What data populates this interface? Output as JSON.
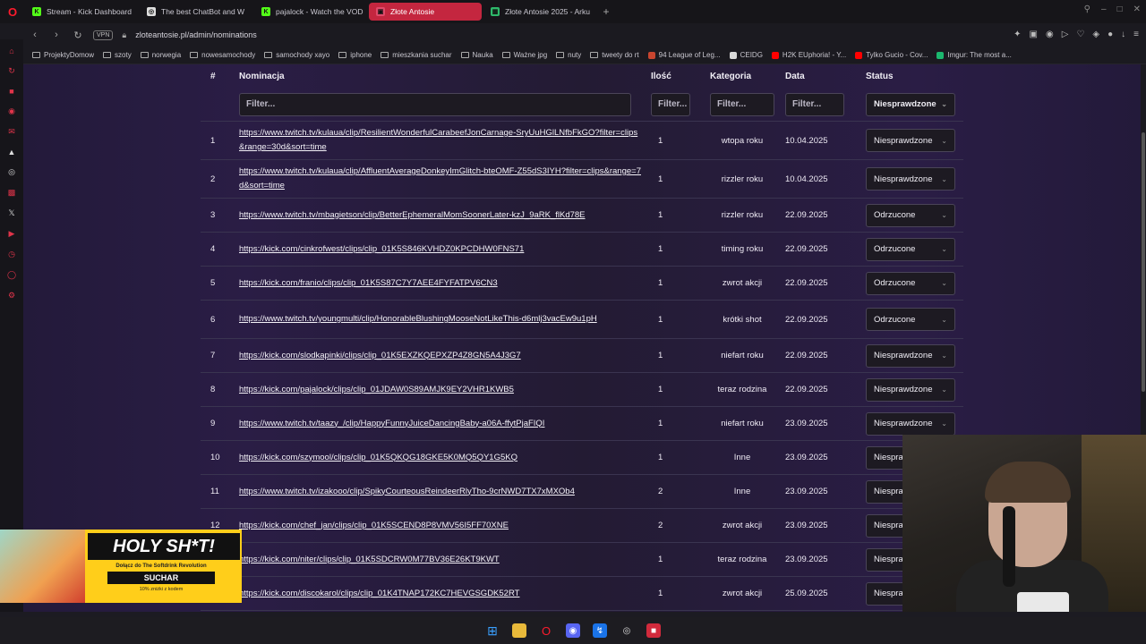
{
  "tabs": [
    {
      "label": "Stream - Kick Dashboard",
      "fav": "K",
      "color": "#53fc18"
    },
    {
      "label": "The best ChatBot and W",
      "fav": "◎",
      "color": "#dddddd"
    },
    {
      "label": "pajalock - Watch the VOD",
      "fav": "K",
      "color": "#53fc18"
    },
    {
      "label": "Złote Antosie",
      "fav": "▣",
      "color": "#e04a6a",
      "active": true
    },
    {
      "label": "Złote Antosie 2025 - Arku",
      "fav": "▦",
      "color": "#2eb86a"
    }
  ],
  "address": {
    "vpn_label": "VPN",
    "url": "zloteantosie.pl/admin/nominations"
  },
  "bookmarks": [
    {
      "label": "ProjektyDomow",
      "type": "folder"
    },
    {
      "label": "szoty",
      "type": "folder"
    },
    {
      "label": "norwegia",
      "type": "folder"
    },
    {
      "label": "nowesamochody",
      "type": "folder"
    },
    {
      "label": "samochody xayo",
      "type": "folder"
    },
    {
      "label": "iphone",
      "type": "folder"
    },
    {
      "label": "mieszkania suchar",
      "type": "folder"
    },
    {
      "label": "Nauka",
      "type": "folder"
    },
    {
      "label": "Ważne jpg",
      "type": "folder"
    },
    {
      "label": "nuty",
      "type": "folder"
    },
    {
      "label": "tweety do rt",
      "type": "folder"
    },
    {
      "label": "94 League of Leg...",
      "type": "site",
      "color": "#c8452f"
    },
    {
      "label": "CEIDG",
      "type": "site",
      "color": "#d9d9d9"
    },
    {
      "label": "H2K EUphoria! - Y...",
      "type": "site",
      "color": "#ff0000"
    },
    {
      "label": "Tylko Gucio - Cov...",
      "type": "site",
      "color": "#ff0000"
    },
    {
      "label": "Imgur: The most a...",
      "type": "site",
      "color": "#1bb76e"
    }
  ],
  "table": {
    "headers": {
      "num": "#",
      "nominacja": "Nominacja",
      "ilosc": "Ilość",
      "kategoria": "Kategoria",
      "data": "Data",
      "status": "Status"
    },
    "filters": {
      "nominacja": "Filter...",
      "ilosc": "Filter...",
      "kategoria": "Filter...",
      "data": "Filter...",
      "status": "Niesprawdzone"
    },
    "rows": [
      {
        "num": "1",
        "link": "https://www.twitch.tv/kulaua/clip/ResilientWonderfulCarabeefJonCarnage-SryUuHGlLNfbFkGO?filter=clips&range=30d&sort=time",
        "ilosc": "1",
        "kategoria": "wtopa roku",
        "data": "10.04.2025",
        "status": "Niesprawdzone"
      },
      {
        "num": "2",
        "link": "https://www.twitch.tv/kulaua/clip/AffluentAverageDonkeyImGlitch-bteOMF-Z55dS3IYH?filter=clips&range=7d&sort=time",
        "ilosc": "1",
        "kategoria": "rizzler roku",
        "data": "10.04.2025",
        "status": "Niesprawdzone"
      },
      {
        "num": "3",
        "link": "https://www.twitch.tv/mbagietson/clip/BetterEphemeralMomSoonerLater-kzJ_9aRK_flKd78E",
        "ilosc": "1",
        "kategoria": "rizzler roku",
        "data": "22.09.2025",
        "status": "Odrzucone"
      },
      {
        "num": "4",
        "link": "https://kick.com/cinkrofwest/clips/clip_01K5S846KVHDZ0KPCDHW0FNS71",
        "ilosc": "1",
        "kategoria": "timing roku",
        "data": "22.09.2025",
        "status": "Odrzucone"
      },
      {
        "num": "5",
        "link": "https://kick.com/franio/clips/clip_01K5S87C7Y7AEE4FYFATPV6CN3",
        "ilosc": "1",
        "kategoria": "zwrot akcji",
        "data": "22.09.2025",
        "status": "Odrzucone"
      },
      {
        "num": "6",
        "link": "https://www.twitch.tv/youngmulti/clip/HonorableBlushingMooseNotLikeThis-d6mlj3vacEw9u1pH",
        "ilosc": "1",
        "kategoria": "krótki shot",
        "data": "22.09.2025",
        "status": "Odrzucone"
      },
      {
        "num": "7",
        "link": "https://kick.com/slodkapinki/clips/clip_01K5EXZKQEPXZP4Z8GN5A4J3G7",
        "ilosc": "1",
        "kategoria": "niefart roku",
        "data": "22.09.2025",
        "status": "Niesprawdzone"
      },
      {
        "num": "8",
        "link": "https://kick.com/pajalock/clips/clip_01JDAW0S89AMJK9EY2VHR1KWB5",
        "ilosc": "1",
        "kategoria": "teraz rodzina",
        "data": "22.09.2025",
        "status": "Niesprawdzone"
      },
      {
        "num": "9",
        "link": "https://www.twitch.tv/taazy_/clip/HappyFunnyJuiceDancingBaby-a06A-ffytPjaFIQI",
        "ilosc": "1",
        "kategoria": "niefart roku",
        "data": "23.09.2025",
        "status": "Niesprawdzone"
      },
      {
        "num": "10",
        "link": "https://kick.com/szymool/clips/clip_01K5QKQG18GKE5K0MQ5QY1G5KQ",
        "ilosc": "1",
        "kategoria": "Inne",
        "data": "23.09.2025",
        "status": "Niespra"
      },
      {
        "num": "11",
        "link": "https://www.twitch.tv/izakooo/clip/SpikyCourteousReindeerRlyTho-9crNWD7TX7xMXOb4",
        "ilosc": "2",
        "kategoria": "Inne",
        "data": "23.09.2025",
        "status": "Niespra"
      },
      {
        "num": "12",
        "link": "https://kick.com/chef_jan/clips/clip_01K5SCEND8P8VMV56I5FF70XNE",
        "ilosc": "2",
        "kategoria": "zwrot akcji",
        "data": "23.09.2025",
        "status": "Niespra"
      },
      {
        "num": "",
        "link": "https://kick.com/niter/clips/clip_01K5SDCRW0M77BV36E26KT9KWT",
        "ilosc": "1",
        "kategoria": "teraz rodzina",
        "data": "23.09.2025",
        "status": "Niespra"
      },
      {
        "num": "",
        "link": "https://kick.com/discokarol/clips/clip_01K4TNAP172KC7HEVGSGDK52RT",
        "ilosc": "1",
        "kategoria": "zwrot akcji",
        "data": "25.09.2025",
        "status": "Niespra"
      }
    ]
  },
  "promo": {
    "headline": "HOLY SH*T!",
    "line1": "Dołącz do The Softdrink Revolution",
    "brand": "SUCHAR",
    "line2": "10% zniżki z kodem"
  }
}
